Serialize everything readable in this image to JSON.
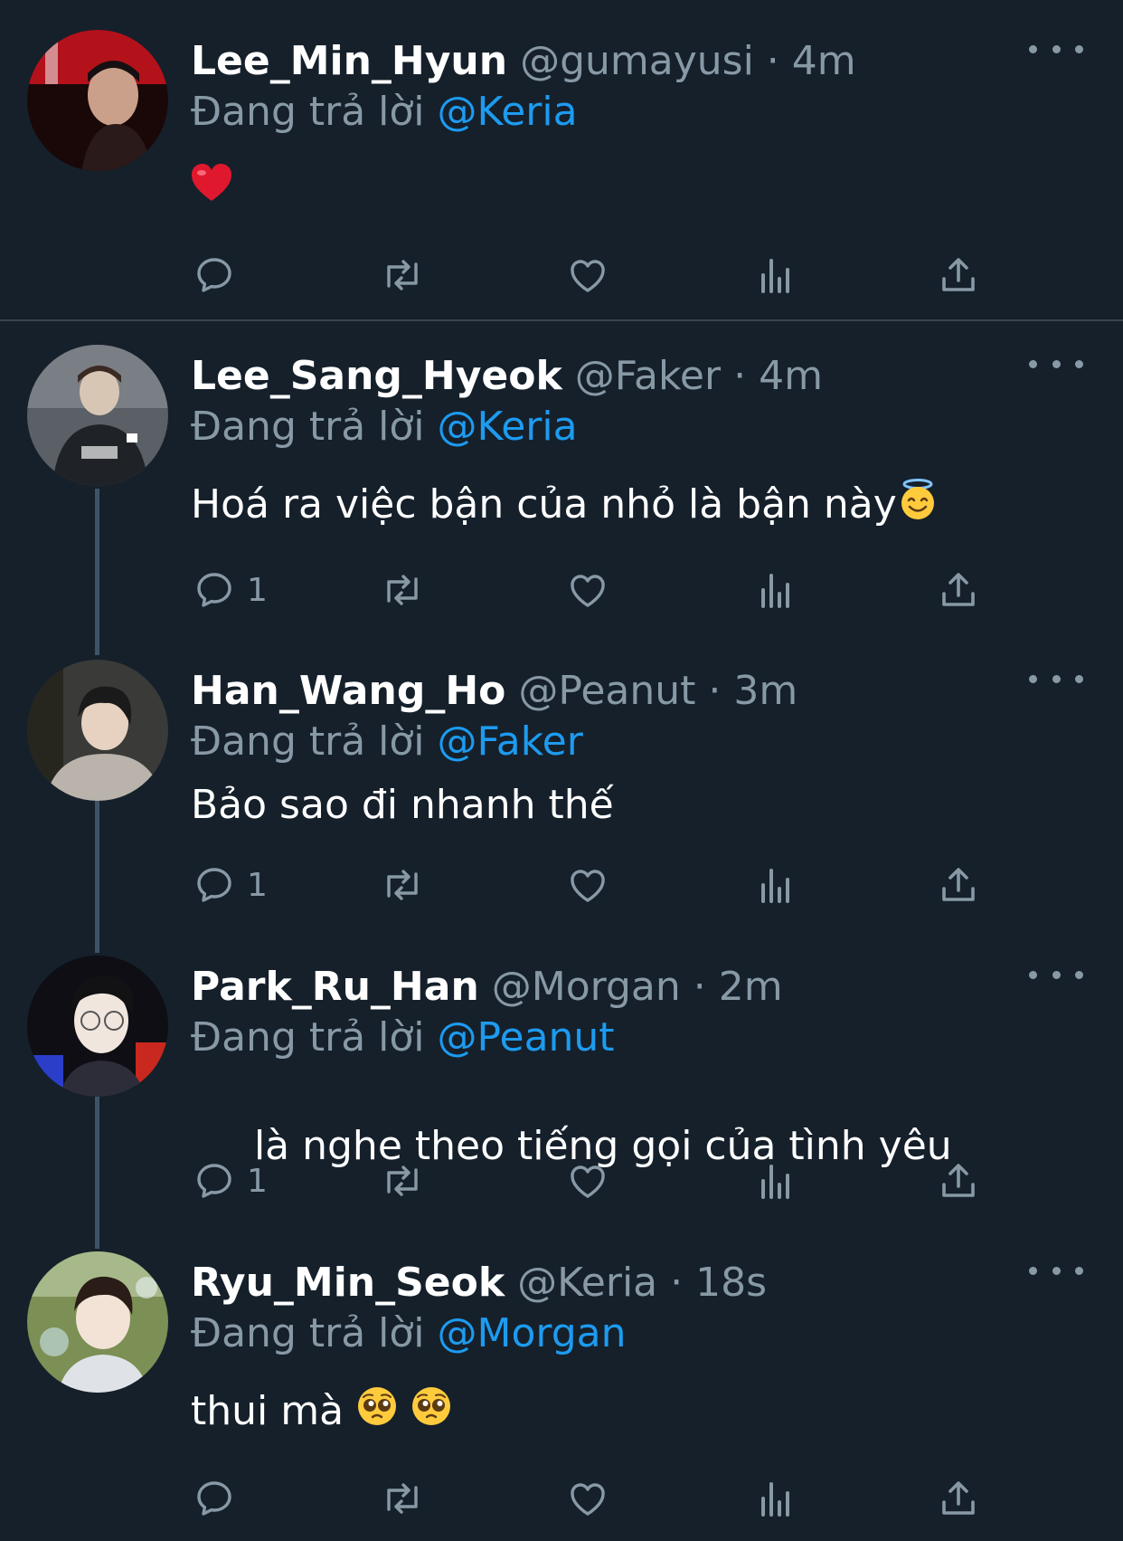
{
  "reply_prefix": "Đang trả lời",
  "tweets": [
    {
      "name": "Lee_Min_Hyun",
      "handle": "@gumayusi",
      "time": "4m",
      "reply_to": "@Keria",
      "text": "",
      "emojis": [
        "red-heart"
      ],
      "reply_count": "",
      "avatar_colors": [
        "#1a0808",
        "#b3121b",
        "#2a1a1a"
      ]
    },
    {
      "name": "Lee_Sang_Hyeok",
      "handle": "@Faker",
      "time": "4m",
      "reply_to": "@Keria",
      "text": "Hoá ra việc bận của nhỏ là bận này",
      "emojis": [
        "smiling-face-with-halo"
      ],
      "reply_count": "1",
      "avatar_colors": [
        "#5b5f66",
        "#1f2328",
        "#d8c6b4"
      ]
    },
    {
      "name": "Han_Wang_Ho",
      "handle": "@Peanut",
      "time": "3m",
      "reply_to": "@Faker",
      "text": "Bảo sao đi nhanh thế",
      "emojis": [],
      "reply_count": "1",
      "avatar_colors": [
        "#3a3a38",
        "#b9b3ab",
        "#1b1a1a"
      ]
    },
    {
      "name": "Park_Ru_Han",
      "handle": "@Morgan",
      "time": "2m",
      "reply_to": "@Peanut",
      "text": " là nghe theo tiếng gọi của tình yêu",
      "emojis": [],
      "reply_count": "1",
      "avatar_colors": [
        "#0e0e14",
        "#f1e6de",
        "#2d2d3a"
      ]
    },
    {
      "name": "Ryu_Min_Seok",
      "handle": "@Keria",
      "time": "18s",
      "reply_to": "@Morgan",
      "text": "thui mà",
      "emojis": [
        "pleading-face",
        "pleading-face"
      ],
      "reply_count": "",
      "avatar_colors": [
        "#7c8f55",
        "#f3e3d6",
        "#dfe3e8"
      ]
    }
  ],
  "icons": [
    "comment-icon",
    "retweet-icon",
    "like-icon",
    "views-icon",
    "share-icon",
    "more-icon"
  ],
  "colors": {
    "background": "#15202b",
    "muted": "#8899a6",
    "mention": "#1d9bf0",
    "thread_line": "#3d5466"
  }
}
